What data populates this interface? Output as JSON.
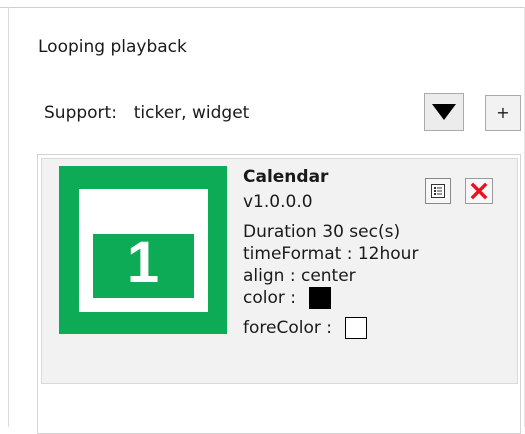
{
  "header": {
    "title": "Looping playback",
    "support_label": "Support:",
    "support_value": "ticker, widget",
    "dropdown_icon": "triangle-down-icon",
    "add_label": "+"
  },
  "items": [
    {
      "name": "Calendar",
      "version": "v1.0.0.0",
      "duration_label": "Duration",
      "duration_value": "30 sec(s)",
      "time_format_label": "timeFormat :",
      "time_format_value": "12hour",
      "align_label": "align :",
      "align_value": "center",
      "color_label": "color :",
      "color_value": "#000000",
      "fore_color_label": "foreColor :",
      "fore_color_value": "#ffffff",
      "thumbnail_icon": "calendar-icon",
      "thumbnail_number": "1",
      "thumbnail_color": "#0eab57",
      "edit_icon": "list-edit-icon",
      "delete_icon": "close-x-icon",
      "delete_color": "#e81123"
    }
  ]
}
